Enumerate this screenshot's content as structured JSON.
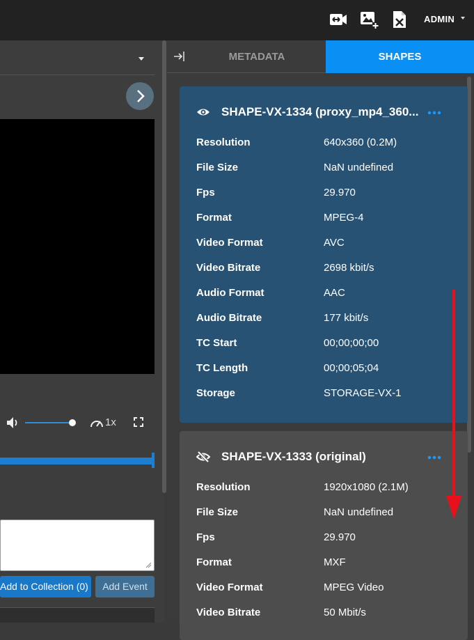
{
  "topbar": {
    "icons": [
      "video-swap-icon",
      "add-image-icon",
      "delete-file-icon"
    ],
    "user_label": "ADMIN"
  },
  "player": {
    "speed_label": "1x",
    "volume_level": 1.0,
    "progress": 1.0
  },
  "actions": {
    "collection_label": "Add to Collection (0)",
    "event_label": "Add Event"
  },
  "tabs": {
    "metadata_label": "METADATA",
    "shapes_label": "SHAPES",
    "active": "SHAPES"
  },
  "shapes": [
    {
      "title": "SHAPE-VX-1334 (proxy_mp4_360...",
      "visibility_icon": "eye-icon",
      "rows": [
        {
          "label": "Resolution",
          "value": "640x360 (0.2M)"
        },
        {
          "label": "File Size",
          "value": "NaN undefined"
        },
        {
          "label": "Fps",
          "value": "29.970"
        },
        {
          "label": "Format",
          "value": "MPEG-4"
        },
        {
          "label": "Video Format",
          "value": "AVC"
        },
        {
          "label": "Video Bitrate",
          "value": "2698 kbit/s"
        },
        {
          "label": "Audio Format",
          "value": "AAC"
        },
        {
          "label": "Audio Bitrate",
          "value": "177 kbit/s"
        },
        {
          "label": "TC Start",
          "value": "00;00;00;00"
        },
        {
          "label": "TC Length",
          "value": "00;00;05;04"
        },
        {
          "label": "Storage",
          "value": "STORAGE-VX-1"
        }
      ]
    },
    {
      "title": "SHAPE-VX-1333 (original)",
      "visibility_icon": "eye-off-icon",
      "rows": [
        {
          "label": "Resolution",
          "value": "1920x1080 (2.1M)"
        },
        {
          "label": "File Size",
          "value": "NaN undefined"
        },
        {
          "label": "Fps",
          "value": "29.970"
        },
        {
          "label": "Format",
          "value": "MXF"
        },
        {
          "label": "Video Format",
          "value": "MPEG Video"
        },
        {
          "label": "Video Bitrate",
          "value": "50 Mbit/s"
        }
      ]
    }
  ],
  "colors": {
    "accent": "#0a8ff5",
    "card_active": "#285274",
    "card_inactive": "#4d4d4d",
    "annotation_arrow": "#e8111b"
  }
}
